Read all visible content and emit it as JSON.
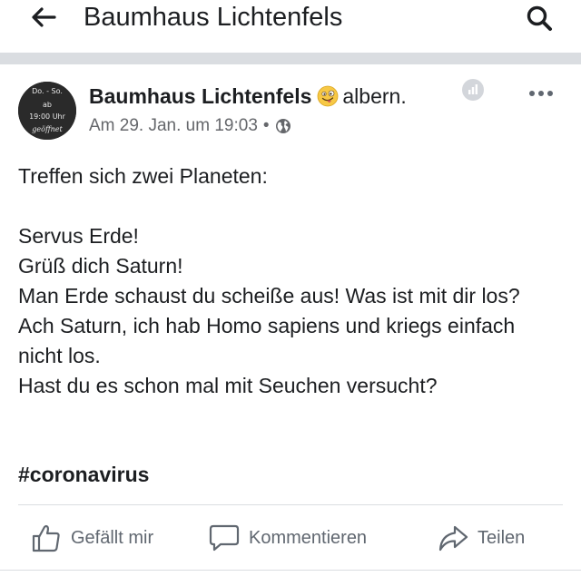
{
  "header": {
    "title": "Baumhaus Lichtenfels",
    "back_icon": "arrow-left-icon",
    "search_icon": "search-icon"
  },
  "post": {
    "author": "Baumhaus Lichtenfels",
    "feeling_emoji": "silly-face-emoji",
    "feeling": "albern.",
    "timestamp": "Am 29. Jan. um 19:03",
    "separator_dot": "•",
    "privacy_icon": "globe-icon",
    "avatar_text": {
      "line1": "Do. - So.",
      "line2": "ab",
      "line3": "19:00 Uhr",
      "line4": "geöffnet"
    },
    "text_lines": [
      "Treffen sich zwei Planeten:",
      "Servus Erde!",
      "Grüß dich Saturn!",
      "Man Erde schaust du scheiße aus! Was ist mit dir los?",
      "Ach Saturn, ich hab Homo sapiens und kriegs einfach nicht los.",
      "Hast du es schon mal mit Seuchen versucht?"
    ],
    "hashtag": "#coronavirus"
  },
  "actions": {
    "like": "Gefällt mir",
    "comment": "Kommentieren",
    "share": "Teilen"
  },
  "colors": {
    "text": "#1c1e21",
    "secondary": "#65676b",
    "separator": "#dadde1"
  }
}
